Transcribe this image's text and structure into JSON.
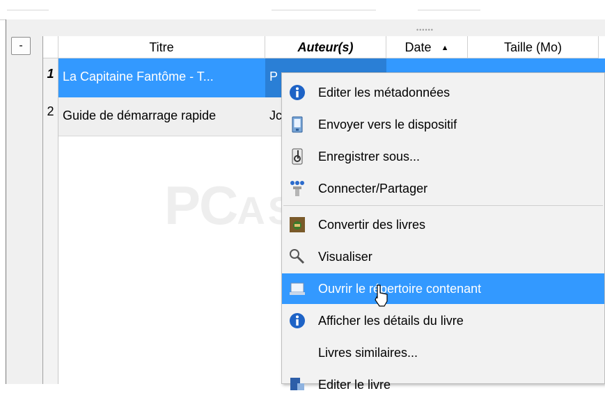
{
  "table": {
    "columns": {
      "title": "Titre",
      "author": "Auteur(s)",
      "date": "Date",
      "size": "Taille (Mo)"
    },
    "collapse_label": "-",
    "rows": [
      {
        "num": "1",
        "title": "La Capitaine Fantôme - T...",
        "author": "P"
      },
      {
        "num": "2",
        "title": "Guide de démarrage rapide",
        "author": "Jc"
      }
    ]
  },
  "context_menu": {
    "items": [
      {
        "label": "Editer les métadonnées",
        "icon": "info-icon"
      },
      {
        "label": "Envoyer vers le dispositif",
        "icon": "device-icon"
      },
      {
        "label": "Enregistrer sous...",
        "icon": "save-icon"
      },
      {
        "label": "Connecter/Partager",
        "icon": "share-icon"
      },
      {
        "label": "Convertir des livres",
        "icon": "convert-icon"
      },
      {
        "label": "Visualiser",
        "icon": "magnifier-icon"
      },
      {
        "label": "Ouvrir le répertoire contenant",
        "icon": "folder-icon"
      },
      {
        "label": "Afficher les détails du livre",
        "icon": "info-icon"
      },
      {
        "label": "Livres similaires...",
        "icon": ""
      },
      {
        "label": "Editer le livre",
        "icon": "edit-book-icon"
      }
    ],
    "highlighted_index": 6
  },
  "colors": {
    "selection": "#3399ff",
    "info_icon": "#1e63c6"
  }
}
